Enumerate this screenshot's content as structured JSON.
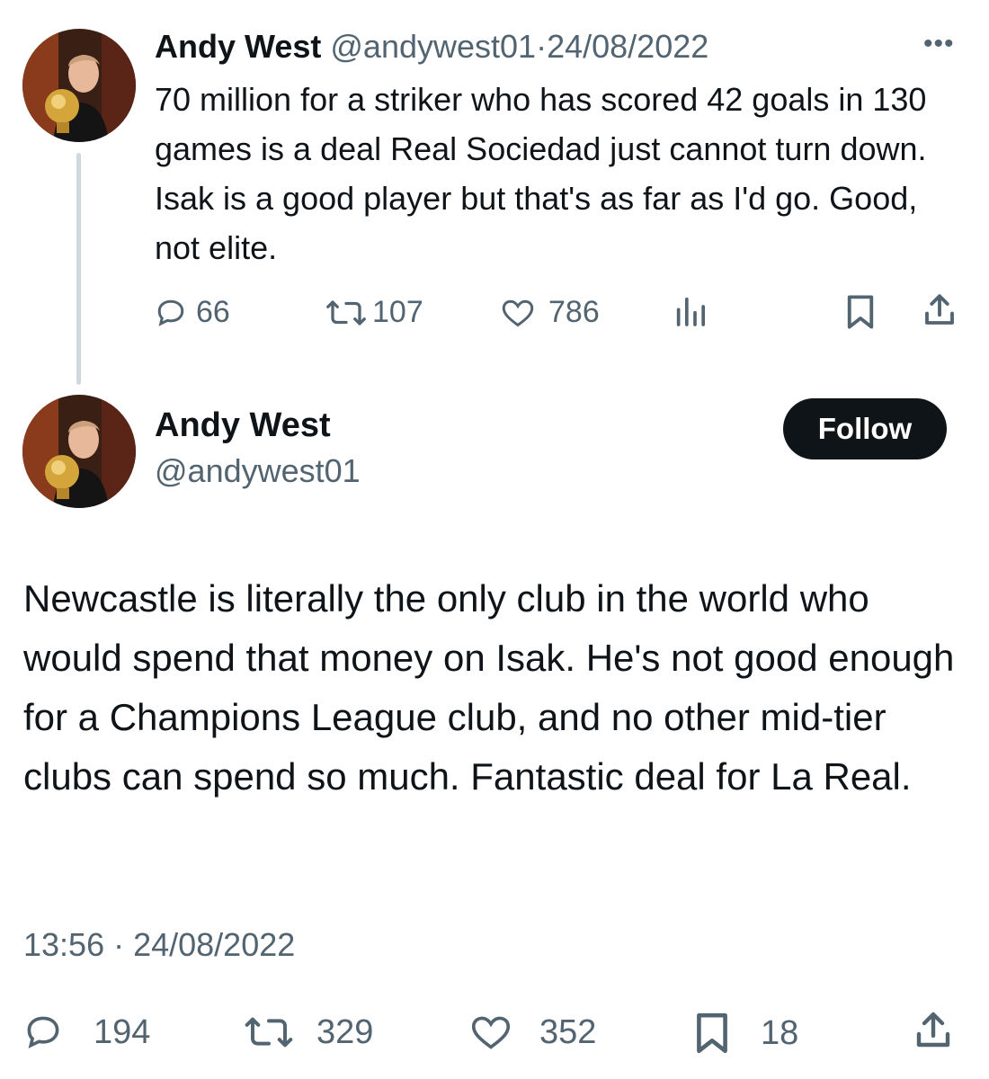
{
  "tweet1": {
    "author_name": "Andy West",
    "handle": "@andywest01",
    "separator": "·",
    "date": "24/08/2022",
    "more_label": "•••",
    "text": "70 million for a striker who has scored 42 goals in 130 games is a deal Real Sociedad just cannot turn down. Isak is a good player but that's as far as I'd go. Good, not elite.",
    "replies": "66",
    "retweets": "107",
    "likes": "786",
    "icons": [
      "reply-icon",
      "retweet-icon",
      "like-icon",
      "views-icon",
      "bookmark-icon",
      "share-icon"
    ]
  },
  "tweet2": {
    "author_name": "Andy West",
    "handle": "@andywest01",
    "follow_label": "Follow",
    "text": "Newcastle is literally the only club in the world who would spend that money on Isak. He's not good enough for a Champions League club, and no other mid-tier clubs can spend so much. Fantastic deal for La Real.",
    "timestamp": "13:56 · 24/08/2022",
    "replies": "194",
    "retweets": "329",
    "likes": "352",
    "bookmarks": "18",
    "icons": [
      "reply-icon",
      "retweet-icon",
      "like-icon",
      "bookmark-icon",
      "share-icon"
    ]
  },
  "colors": {
    "text": "#0f1419",
    "muted": "#536471",
    "thread_line": "#cfd9de",
    "follow_bg": "#0f1419",
    "follow_text": "#ffffff"
  }
}
